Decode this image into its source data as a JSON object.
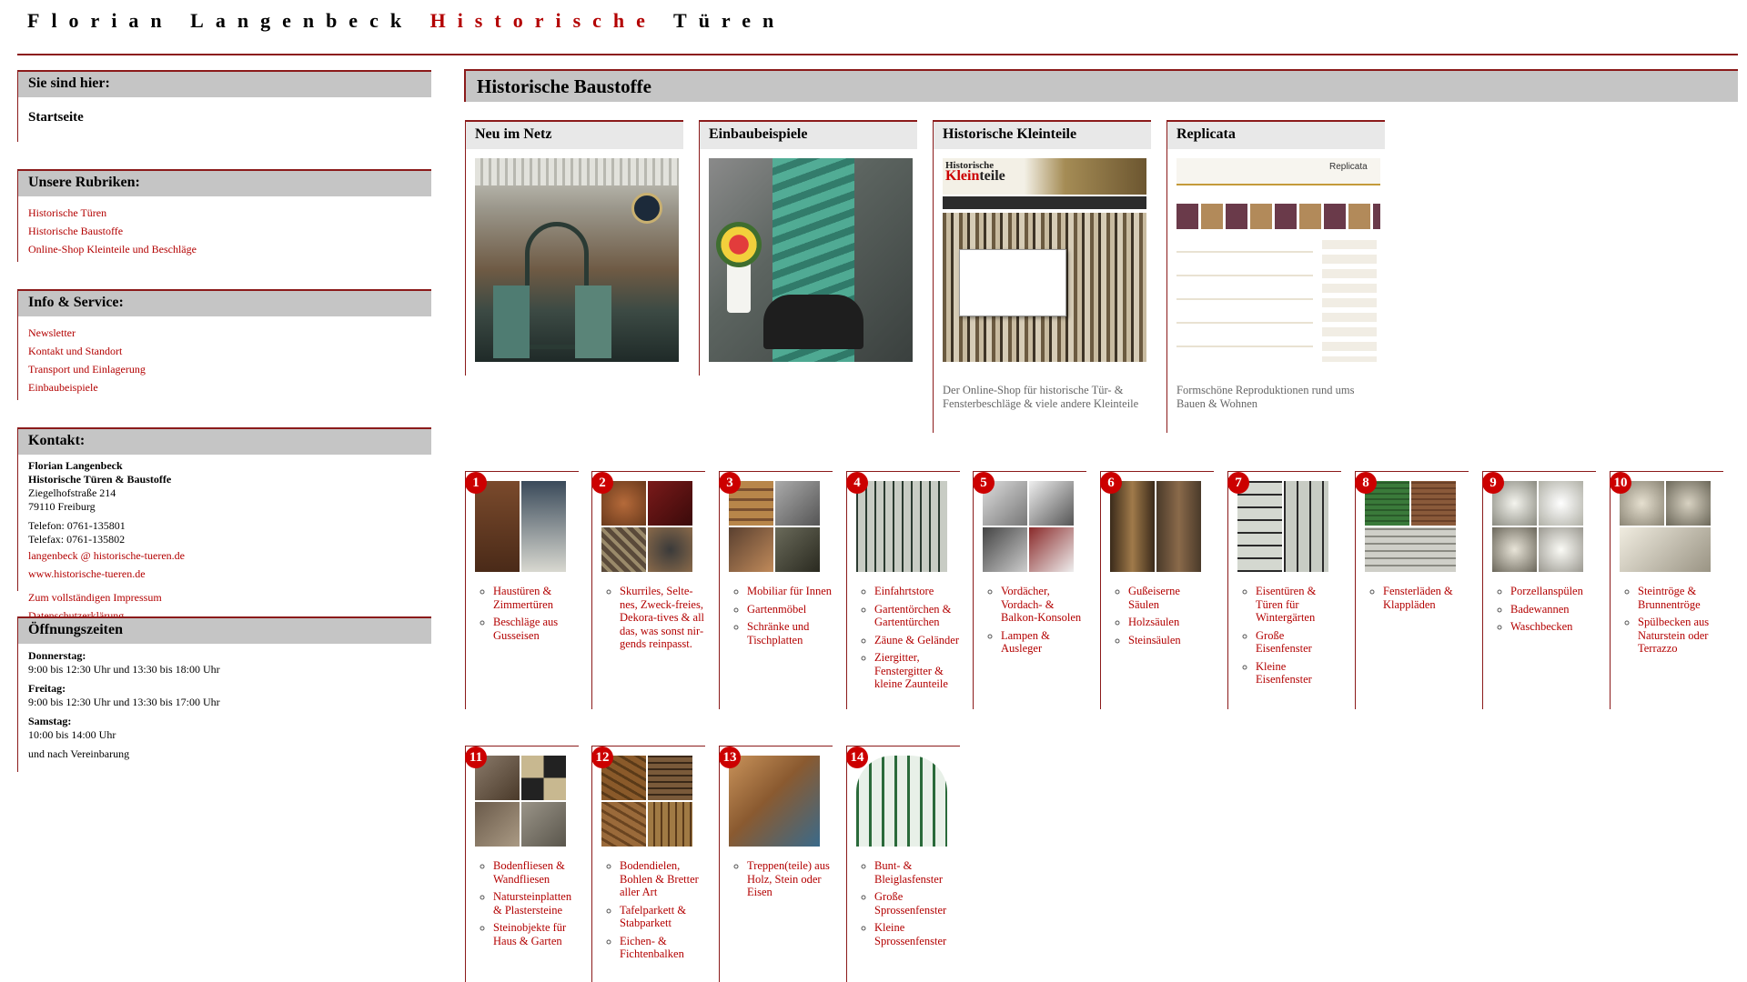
{
  "header": {
    "name": "Florian Langenbeck",
    "red_part": "Historische",
    "last_part": "Türen"
  },
  "sidebar": {
    "location": {
      "title": "Sie sind hier:",
      "current": "Startseite"
    },
    "categories": {
      "title": "Unsere Rubriken:",
      "items": [
        "Historische Türen",
        "Historische Baustoffe",
        "Online-Shop Kleinteile und Beschläge"
      ]
    },
    "service": {
      "title": "Info & Service:",
      "items": [
        "Newsletter",
        "Kontakt und Standort",
        "Transport und Einlagerung",
        "Einbaubeispiele"
      ]
    },
    "contact": {
      "title": "Kontakt:",
      "name": "Florian Langenbeck",
      "company": "Historische Türen & Baustoffe",
      "street": "Ziegelhofstraße 214",
      "city": "79110 Freiburg",
      "phone": "Telefon: 0761-135801",
      "fax": "Telefax: 0761-135802",
      "email": "langenbeck @ historische-tueren.de",
      "website": "www.historische-tueren.de",
      "impressum": "Zum vollständigen Impressum",
      "privacy": "Datenschutzerklärung"
    },
    "hours": {
      "title": "Öffnungszeiten",
      "thursday_label": "Donnerstag:",
      "thursday": "9:00 bis 12:30 Uhr und 13:30 bis 18:00 Uhr",
      "friday_label": "Freitag:",
      "friday": "9:00 bis 12:30 Uhr und 13:30 bis 17:00 Uhr",
      "saturday_label": "Samstag:",
      "saturday": "10:00 bis 14:00 Uhr",
      "note": "und nach Vereinbarung"
    }
  },
  "main": {
    "title": "Historische Baustoffe",
    "features": [
      {
        "title": "Neu im Netz",
        "caption": ""
      },
      {
        "title": "Einbaubeispiele",
        "caption": ""
      },
      {
        "title": "Historische Kleinteile",
        "caption": "Der Online-Shop für historische Tür- & Fensterbeschläge & viele andere Kleinteile"
      },
      {
        "title": "Replicata",
        "caption": "Formschöne Reproduktionen rund ums Bauen & Wohnen"
      }
    ],
    "categories": [
      {
        "num": "1",
        "items": [
          "Haustüren & Zimmertüren",
          "Beschläge aus Gusseisen"
        ]
      },
      {
        "num": "2",
        "items": [
          "Skurriles, Selte-nes, Zweck-freies, Dekora-tives & all das, was sonst nir-gends reinpasst."
        ]
      },
      {
        "num": "3",
        "items": [
          "Mobiliar für Innen",
          "Gartenmöbel",
          "Schränke und Tischplatten"
        ]
      },
      {
        "num": "4",
        "items": [
          "Einfahrtstore",
          "Gartentörchen & Gartentürchen",
          "Zäune & Geländer",
          "Ziergitter, Fenstergitter & kleine Zaunteile"
        ]
      },
      {
        "num": "5",
        "items": [
          "Vordächer, Vordach- & Balkon-Konsolen",
          "Lampen & Ausleger"
        ]
      },
      {
        "num": "6",
        "items": [
          "Gußeiserne Säulen",
          "Holzsäulen",
          "Steinsäulen"
        ]
      },
      {
        "num": "7",
        "items": [
          "Eisentüren & Türen für Wintergärten",
          "Große Eisenfenster",
          "Kleine Eisenfenster"
        ]
      },
      {
        "num": "8",
        "items": [
          "Fensterläden & Klappläden"
        ]
      },
      {
        "num": "9",
        "items": [
          "Porzellanspülen",
          "Badewannen",
          "Waschbecken"
        ]
      },
      {
        "num": "10",
        "items": [
          "Steintröge & Brunnentröge",
          "Spülbecken aus Naturstein oder Terrazzo"
        ]
      },
      {
        "num": "11",
        "items": [
          "Bodenfliesen & Wandfliesen",
          "Natursteinplatten & Plastersteine",
          "Steinobjekte für Haus & Garten"
        ]
      },
      {
        "num": "12",
        "items": [
          "Bodendielen, Bohlen & Bretter aller Art",
          "Tafelparkett & Stabparkett",
          "Eichen- & Fichtenbalken"
        ]
      },
      {
        "num": "13",
        "items": [
          "Treppen(teile) aus Holz, Stein oder Eisen"
        ]
      },
      {
        "num": "14",
        "items": [
          "Bunt- & Bleiglasfenster",
          "Große Sprossenfenster",
          "Kleine Sprossenfenster"
        ]
      }
    ]
  },
  "colors": {
    "accent": "#b30000",
    "rule": "#8b1a1a",
    "box": "#c5c5c5"
  }
}
